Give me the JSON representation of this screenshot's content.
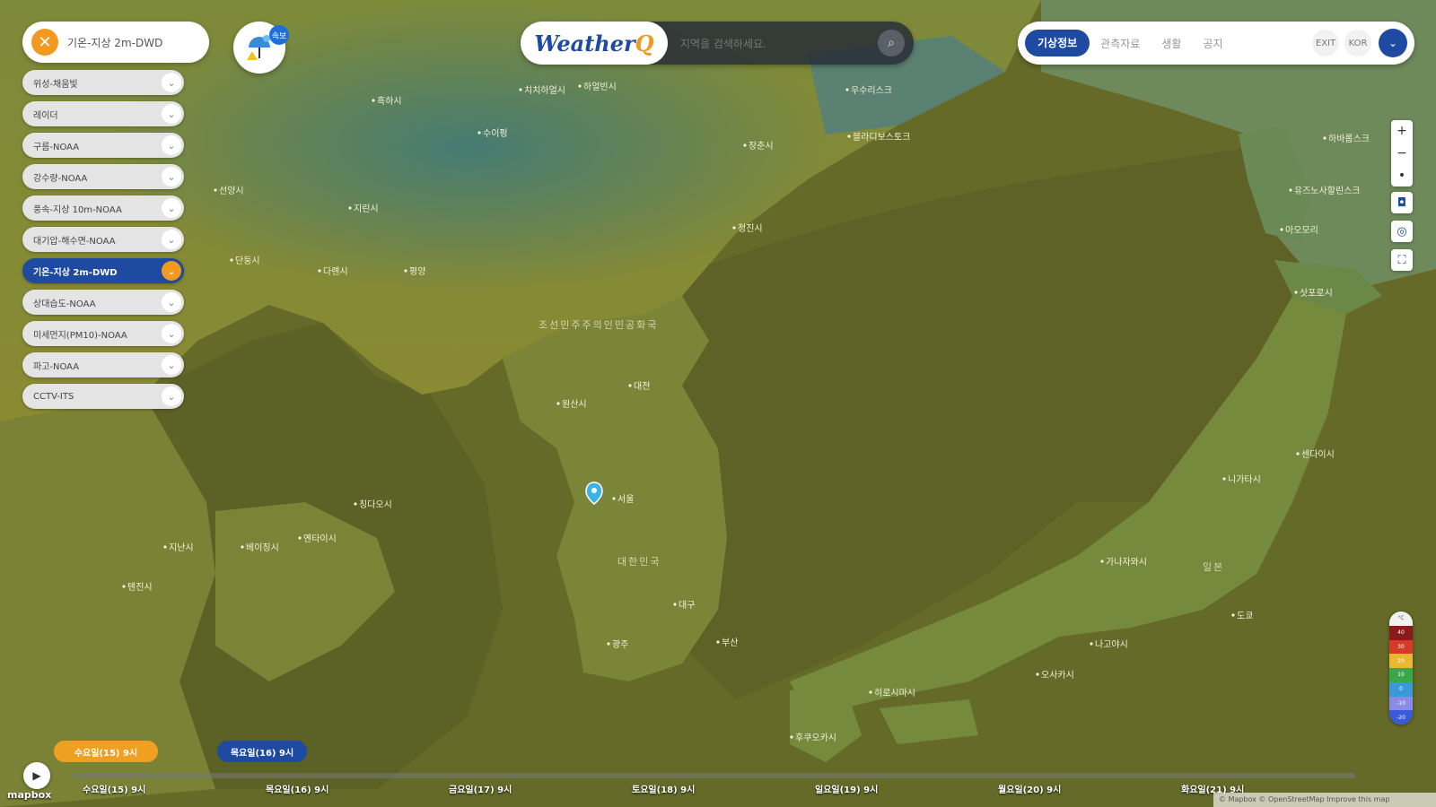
{
  "layer_panel": {
    "header_label": "기온-지상 2m-DWD",
    "close_icon": "close-icon",
    "items": [
      {
        "label": "위성-채움빛"
      },
      {
        "label": "레이더"
      },
      {
        "label": "구름-NOAA"
      },
      {
        "label": "강수량-NOAA"
      },
      {
        "label": "풍속-지상 10m-NOAA"
      },
      {
        "label": "대기압-해수면-NOAA"
      },
      {
        "label": "기온-지상 2m-DWD",
        "active": true
      },
      {
        "label": "상대습도-NOAA"
      },
      {
        "label": "미세먼지(PM10)-NOAA"
      },
      {
        "label": "파고-NOAA"
      },
      {
        "label": "CCTV-ITS"
      }
    ]
  },
  "weather_badge": {
    "count": "속보"
  },
  "search": {
    "logo_main": "Weather",
    "logo_q": "Q",
    "placeholder": "지역을 검색하세요."
  },
  "topnav": {
    "tabs": [
      {
        "label": "기상정보",
        "active": true
      },
      {
        "label": "관측자료"
      },
      {
        "label": "생활"
      },
      {
        "label": "공지"
      }
    ],
    "lang": [
      "EXIT",
      "KOR"
    ]
  },
  "map_controls": {
    "zoom_in": "+",
    "zoom_out": "−",
    "reset": "•"
  },
  "legend": {
    "items": [
      {
        "label": "°C",
        "color": "#f2f2f2"
      },
      {
        "label": "40",
        "color": "#8b1a1a"
      },
      {
        "label": "30",
        "color": "#d83a2a"
      },
      {
        "label": "20",
        "color": "#e8b830"
      },
      {
        "label": "10",
        "color": "#3aa84a"
      },
      {
        "label": "0",
        "color": "#3a9ad8"
      },
      {
        "label": "-10",
        "color": "#8a8ae8"
      },
      {
        "label": "-20",
        "color": "#3a5ad8"
      }
    ]
  },
  "timeline": {
    "current": "수요일(15) 9시",
    "hover": "목요일(16) 9시",
    "days": [
      "수요일(15) 9시",
      "목요일(16) 9시",
      "금요일(17) 9시",
      "토요일(18) 9시",
      "일요일(19) 9시",
      "월요일(20) 9시",
      "화요일(21) 9시"
    ]
  },
  "map": {
    "places": [
      "흑하시",
      "치치하얼시",
      "하얼빈시",
      "수이펑",
      "장춘시",
      "지린시",
      "선양시",
      "단둥시",
      "다롄시",
      "평양",
      "원산시",
      "청진시",
      "서울",
      "대전",
      "대구",
      "부산",
      "광주",
      "블라디보스토크",
      "우수리스크",
      "하바롭스크",
      "유즈노사할린스크",
      "삿포로시",
      "아오모리",
      "센다이시",
      "도쿄",
      "나고야시",
      "오사카시",
      "히로시마시",
      "후쿠오카시",
      "니가타시",
      "가나자와시",
      "칭다오시",
      "옌타이시",
      "지난시",
      "톈진시",
      "베이징시"
    ],
    "countries": [
      "조선민주주의인민공화국",
      "대한민국",
      "일본"
    ]
  },
  "footer": {
    "mapbox": "mapbox",
    "attribution": "© Mapbox © OpenStreetMap Improve this map"
  }
}
